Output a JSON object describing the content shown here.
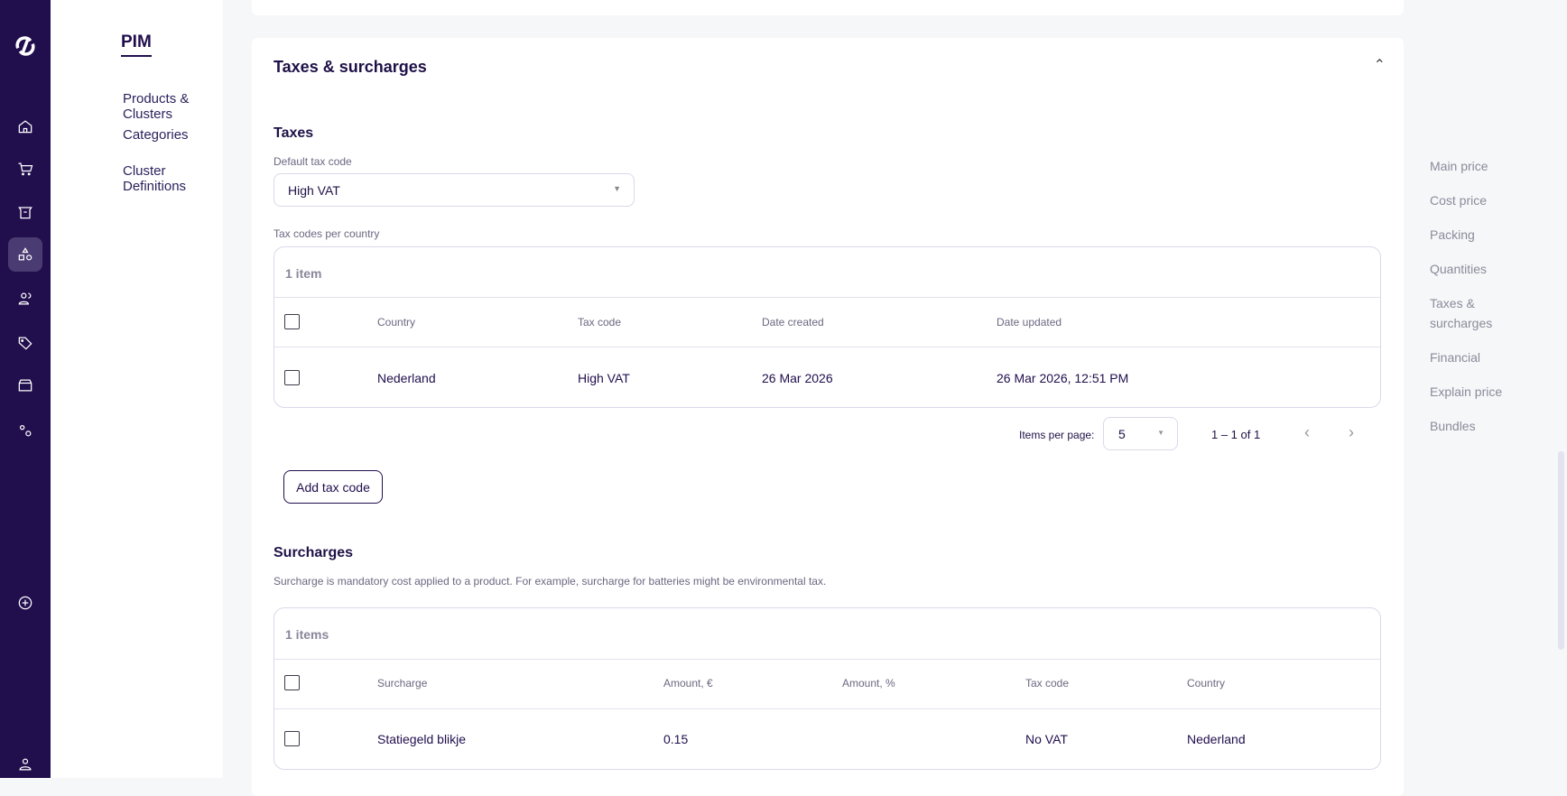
{
  "rail": {
    "icons": [
      "logo-icon",
      "home-icon",
      "cart-icon",
      "box-icon",
      "shapes-icon",
      "users-icon",
      "tag-icon",
      "store-icon",
      "settings-icon",
      "add-icon",
      "user-icon"
    ]
  },
  "subnav": {
    "title": "PIM",
    "items": [
      "Products & Clusters",
      "Categories",
      "Cluster Definitions"
    ]
  },
  "section": {
    "title": "Taxes & surcharges"
  },
  "taxes": {
    "heading": "Taxes",
    "default_label": "Default tax code",
    "default_value": "High VAT",
    "per_country_label": "Tax codes per country",
    "count": "1 item",
    "columns": [
      "Country",
      "Tax code",
      "Date created",
      "Date updated"
    ],
    "rows": [
      {
        "country": "Nederland",
        "tax_code": "High VAT",
        "created": "26 Mar 2026",
        "updated": "26 Mar 2026, 12:51 PM"
      }
    ],
    "items_per_page_label": "Items per page:",
    "items_per_page": "5",
    "range": "1 – 1 of 1",
    "add_button": "Add tax code"
  },
  "surcharges": {
    "heading": "Surcharges",
    "description": "Surcharge is mandatory cost applied to a product. For example, surcharge for batteries might be environmental tax.",
    "count": "1 items",
    "columns": [
      "Surcharge",
      "Amount, €",
      "Amount, %",
      "Tax code",
      "Country"
    ],
    "rows": [
      {
        "surcharge": "Statiegeld blikje",
        "amount_eur": "0.15",
        "amount_pct": "",
        "tax_code": "No VAT",
        "country": "Nederland"
      }
    ]
  },
  "right_nav": [
    "Main price",
    "Cost price",
    "Packing",
    "Quantities",
    "Taxes &",
    "surcharges",
    "Financial",
    "Explain price",
    "Bundles"
  ]
}
